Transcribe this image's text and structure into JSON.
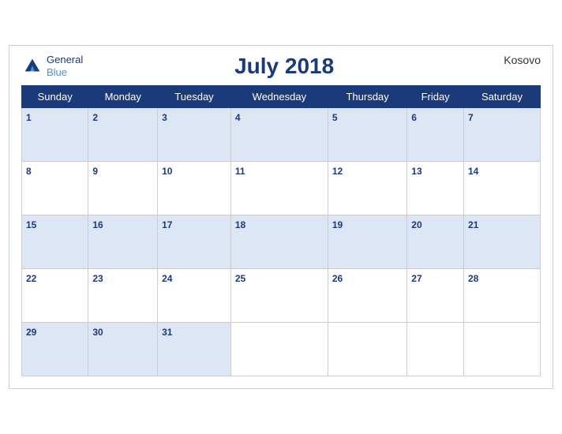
{
  "header": {
    "title": "July 2018",
    "country": "Kosovo",
    "logo_general": "General",
    "logo_blue": "Blue"
  },
  "weekdays": [
    "Sunday",
    "Monday",
    "Tuesday",
    "Wednesday",
    "Thursday",
    "Friday",
    "Saturday"
  ],
  "weeks": [
    [
      {
        "day": "1",
        "empty": false
      },
      {
        "day": "2",
        "empty": false
      },
      {
        "day": "3",
        "empty": false
      },
      {
        "day": "4",
        "empty": false
      },
      {
        "day": "5",
        "empty": false
      },
      {
        "day": "6",
        "empty": false
      },
      {
        "day": "7",
        "empty": false
      }
    ],
    [
      {
        "day": "8",
        "empty": false
      },
      {
        "day": "9",
        "empty": false
      },
      {
        "day": "10",
        "empty": false
      },
      {
        "day": "11",
        "empty": false
      },
      {
        "day": "12",
        "empty": false
      },
      {
        "day": "13",
        "empty": false
      },
      {
        "day": "14",
        "empty": false
      }
    ],
    [
      {
        "day": "15",
        "empty": false
      },
      {
        "day": "16",
        "empty": false
      },
      {
        "day": "17",
        "empty": false
      },
      {
        "day": "18",
        "empty": false
      },
      {
        "day": "19",
        "empty": false
      },
      {
        "day": "20",
        "empty": false
      },
      {
        "day": "21",
        "empty": false
      }
    ],
    [
      {
        "day": "22",
        "empty": false
      },
      {
        "day": "23",
        "empty": false
      },
      {
        "day": "24",
        "empty": false
      },
      {
        "day": "25",
        "empty": false
      },
      {
        "day": "26",
        "empty": false
      },
      {
        "day": "27",
        "empty": false
      },
      {
        "day": "28",
        "empty": false
      }
    ],
    [
      {
        "day": "29",
        "empty": false
      },
      {
        "day": "30",
        "empty": false
      },
      {
        "day": "31",
        "empty": false
      },
      {
        "day": "",
        "empty": true
      },
      {
        "day": "",
        "empty": true
      },
      {
        "day": "",
        "empty": true
      },
      {
        "day": "",
        "empty": true
      }
    ]
  ]
}
